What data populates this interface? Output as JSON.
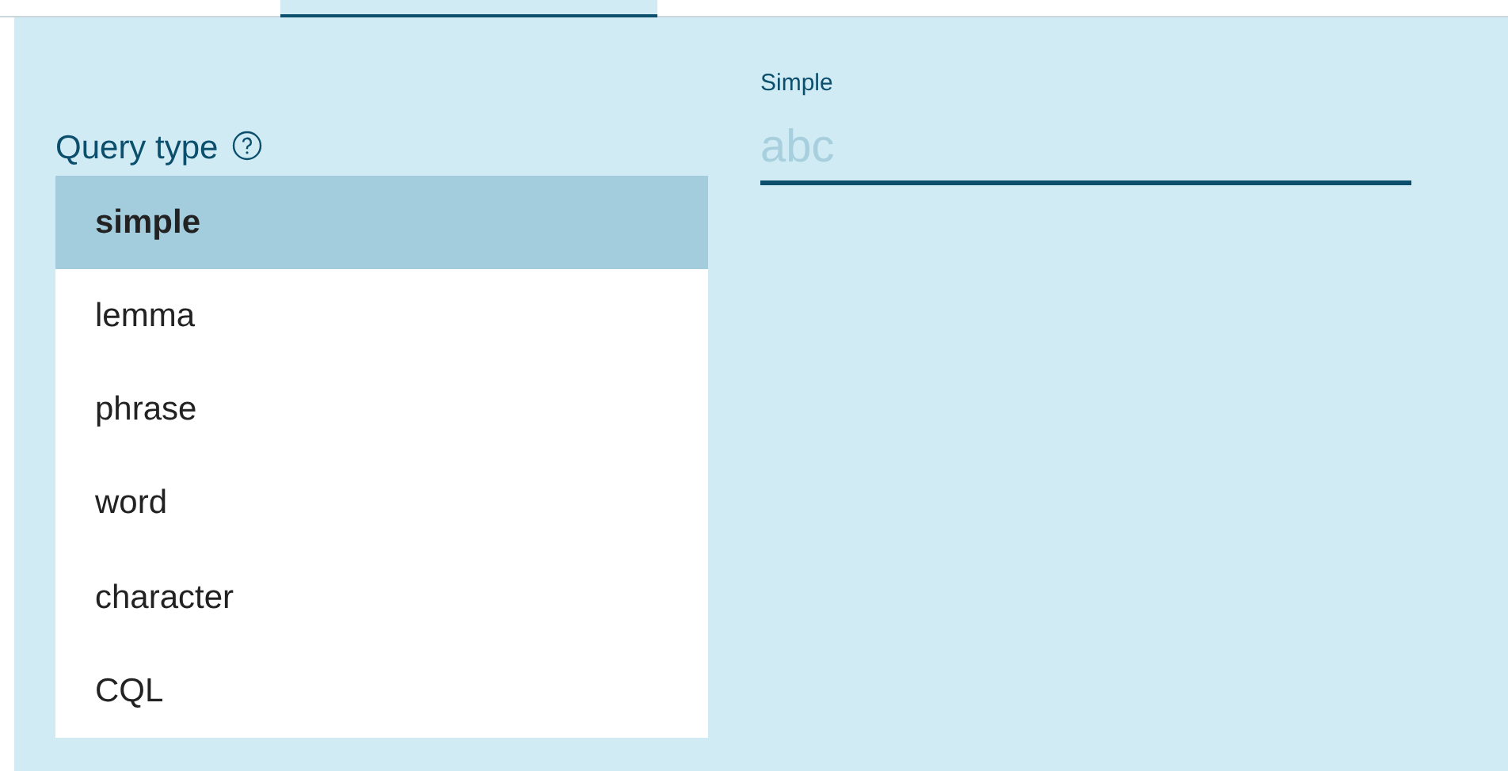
{
  "query_type": {
    "label": "Query type",
    "options": [
      {
        "label": "simple",
        "selected": true
      },
      {
        "label": "lemma",
        "selected": false
      },
      {
        "label": "phrase",
        "selected": false
      },
      {
        "label": "word",
        "selected": false
      },
      {
        "label": "character",
        "selected": false
      },
      {
        "label": "CQL",
        "selected": false
      }
    ]
  },
  "simple_field": {
    "label": "Simple",
    "placeholder": "abc"
  }
}
